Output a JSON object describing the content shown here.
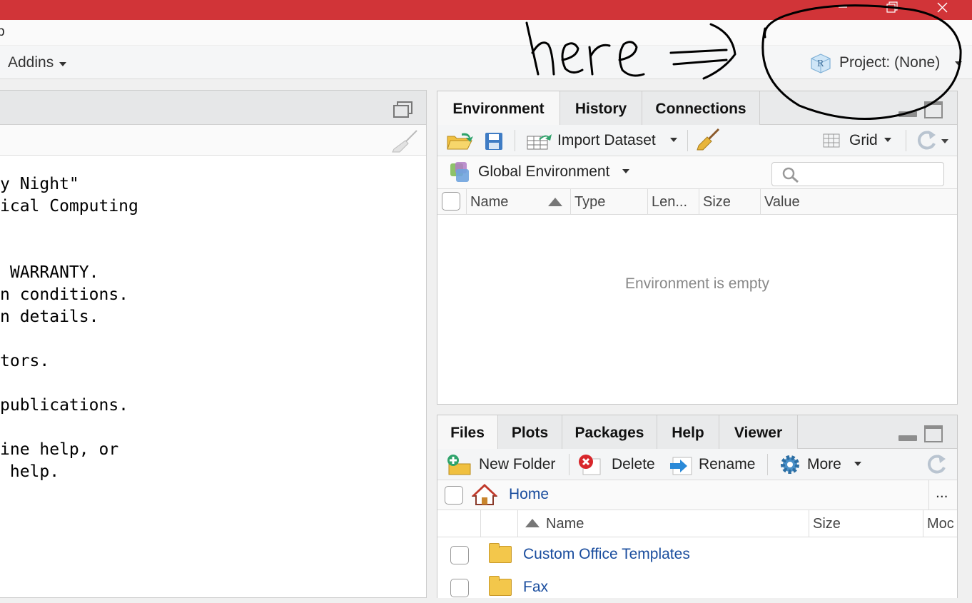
{
  "menubar": {
    "partial_item": "p"
  },
  "toolbar": {
    "addins_label": "Addins",
    "project_label": "Project: (None)"
  },
  "annotation": {
    "handwritten_text": "here"
  },
  "console": {
    "lines": [
      "y Night\"",
      "ical Computing",
      "",
      "",
      " WARRANTY.",
      "n conditions.",
      "n details.",
      "",
      "tors.",
      "",
      "publications.",
      "",
      "ine help, or",
      " help."
    ]
  },
  "env_pane": {
    "tabs": [
      "Environment",
      "History",
      "Connections"
    ],
    "active_tab": "Environment",
    "import_label": "Import Dataset",
    "grid_label": "Grid",
    "scope_label": "Global Environment",
    "search_placeholder": "",
    "columns": [
      "Name",
      "Type",
      "Len...",
      "Size",
      "Value"
    ],
    "empty_message": "Environment is empty"
  },
  "files_pane": {
    "tabs": [
      "Files",
      "Plots",
      "Packages",
      "Help",
      "Viewer"
    ],
    "active_tab": "Files",
    "new_folder_label": "New Folder",
    "delete_label": "Delete",
    "rename_label": "Rename",
    "more_label": "More",
    "breadcrumb_home": "Home",
    "ellipsis": "...",
    "columns": [
      "Name",
      "Size",
      "Moc"
    ],
    "rows": [
      {
        "name": "Custom Office Templates"
      },
      {
        "name": "Fax"
      }
    ]
  },
  "colors": {
    "titlebar": "#d13438",
    "link": "#1a4d9e",
    "folder": "#f3c74b"
  },
  "icons": [
    "minimize-icon",
    "restore-icon",
    "close-icon",
    "r-project-icon",
    "open-folder-icon",
    "save-icon",
    "import-table-icon",
    "broom-icon",
    "grid-icon",
    "refresh-icon",
    "search-icon",
    "add-folder-icon",
    "delete-icon",
    "rename-icon",
    "gear-icon",
    "home-icon",
    "folder-icon"
  ]
}
